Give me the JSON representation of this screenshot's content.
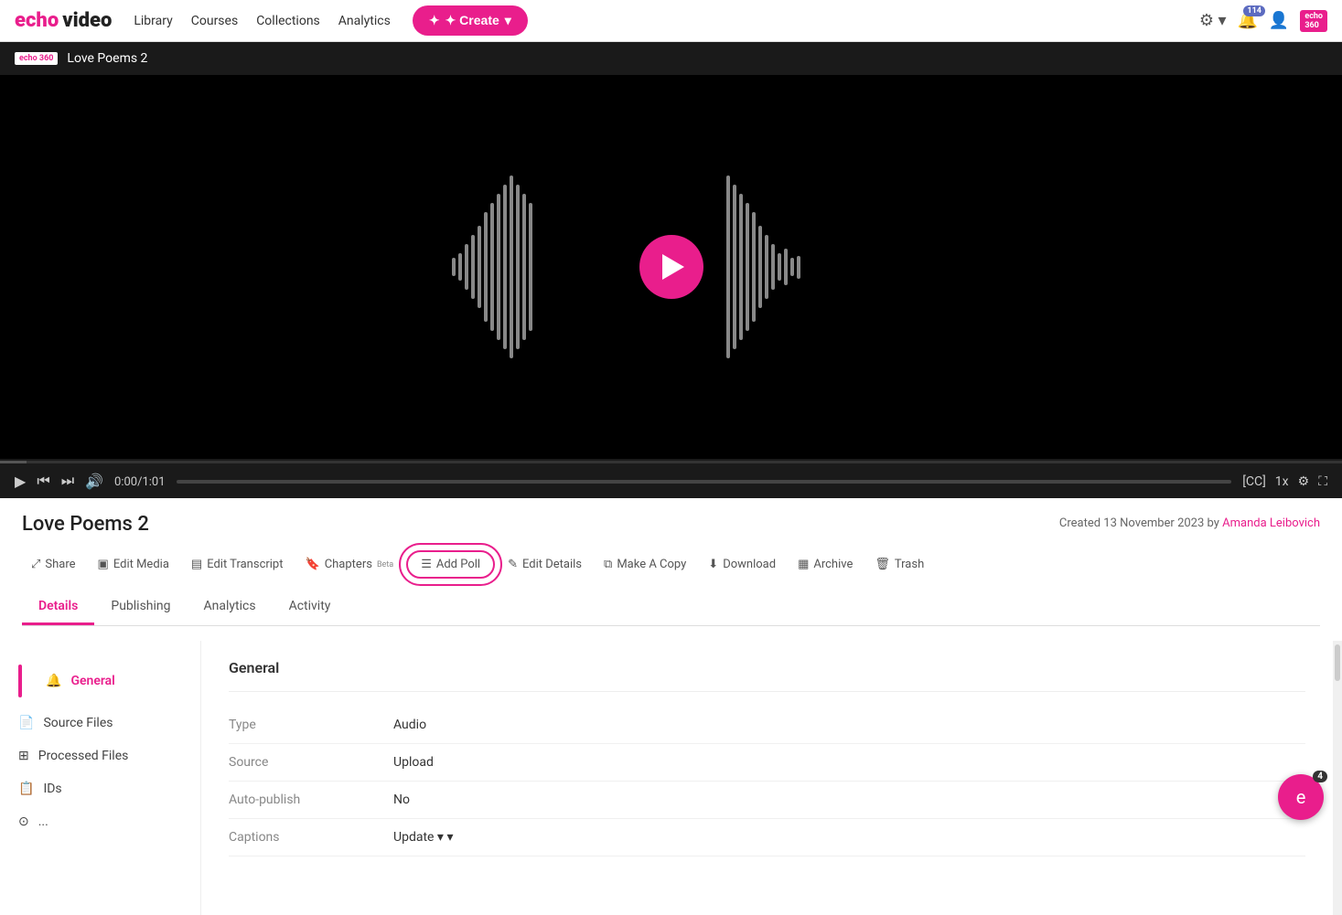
{
  "nav": {
    "logo_echo": "echo",
    "logo_video": "video",
    "links": [
      {
        "label": "Library",
        "id": "library"
      },
      {
        "label": "Courses",
        "id": "courses"
      },
      {
        "label": "Collections",
        "id": "collections"
      },
      {
        "label": "Analytics",
        "id": "analytics"
      }
    ],
    "create_btn": "✦ Create",
    "notification_count": "114",
    "echo360_label": "echo\n360"
  },
  "video": {
    "header_logo": "echo 360",
    "title": "Love Poems 2",
    "time": "0:00/1:01"
  },
  "media": {
    "title": "Love Poems 2",
    "created_label": "Created 13 November 2023 by",
    "creator": "Amanda Leibovich"
  },
  "actions": [
    {
      "id": "share",
      "icon": "⤢",
      "label": "Share"
    },
    {
      "id": "edit-media",
      "icon": "▣",
      "label": "Edit Media"
    },
    {
      "id": "edit-transcript",
      "icon": "▤",
      "label": "Edit Transcript"
    },
    {
      "id": "chapters",
      "icon": "🔖",
      "label": "Chapters",
      "badge": "Beta"
    },
    {
      "id": "add-poll",
      "icon": "☰",
      "label": "Add Poll",
      "highlighted": true
    },
    {
      "id": "edit-details",
      "icon": "✎",
      "label": "Edit Details"
    },
    {
      "id": "make-copy",
      "icon": "⧉",
      "label": "Make A Copy"
    },
    {
      "id": "download",
      "icon": "⬇",
      "label": "Download"
    },
    {
      "id": "archive",
      "icon": "▦",
      "label": "Archive"
    },
    {
      "id": "trash",
      "icon": "🗑",
      "label": "Trash"
    }
  ],
  "tabs": [
    {
      "id": "details",
      "label": "Details",
      "active": true
    },
    {
      "id": "publishing",
      "label": "Publishing"
    },
    {
      "id": "analytics",
      "label": "Analytics"
    },
    {
      "id": "activity",
      "label": "Activity"
    }
  ],
  "sidebar": {
    "items": [
      {
        "id": "general",
        "icon": "🔔",
        "label": "General",
        "active": true
      },
      {
        "id": "source-files",
        "icon": "📄",
        "label": "Source Files"
      },
      {
        "id": "processed-files",
        "icon": "⊞",
        "label": "Processed Files"
      },
      {
        "id": "ids",
        "icon": "📋",
        "label": "IDs"
      },
      {
        "id": "more",
        "icon": "⊙",
        "label": "..."
      }
    ]
  },
  "general": {
    "section_title": "General",
    "fields": [
      {
        "label": "Type",
        "value": "Audio"
      },
      {
        "label": "Source",
        "value": "Upload"
      },
      {
        "label": "Auto-publish",
        "value": "No"
      },
      {
        "label": "Captions",
        "value": "Update ▾"
      }
    ]
  },
  "chat": {
    "count": "4",
    "icon": "e"
  }
}
